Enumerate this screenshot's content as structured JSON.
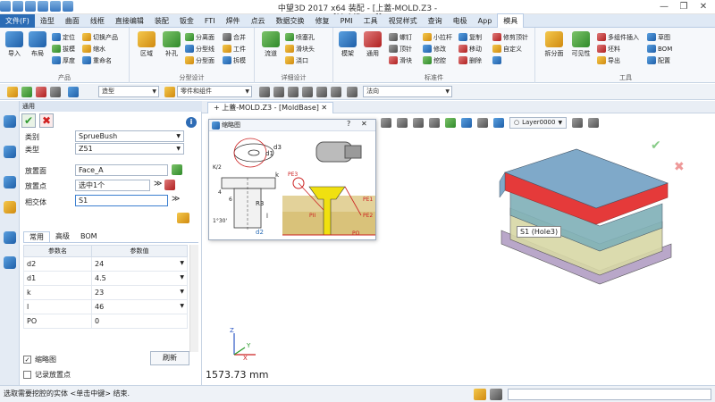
{
  "window": {
    "title": "中望3D 2017    x64          装配 - [上蓋-MOLD.Z3 - [MoldBase]]",
    "controls": [
      "minimize-icon",
      "restore-icon",
      "close-icon"
    ]
  },
  "menu": {
    "items": [
      "文件(F)",
      "造型",
      "曲面",
      "线框",
      "直接编辑",
      "装配",
      "钣金",
      "FTI",
      "焊件",
      "点云",
      "数据交换",
      "修复",
      "PMI",
      "工具",
      "视觉样式",
      "查询",
      "电极",
      "App",
      "模具"
    ],
    "active": "模具"
  },
  "ribbon": {
    "groups": [
      {
        "label": "产品",
        "big": [
          {
            "label": "导入",
            "icon": "import-icon"
          },
          {
            "label": "布局",
            "icon": "layout-icon"
          }
        ],
        "small": [
          "定位",
          "拔模",
          "厚度",
          "切换产品",
          "缩水",
          "重命名"
        ]
      },
      {
        "label": "分型设计",
        "big": [
          {
            "label": "区域",
            "icon": "region-icon"
          },
          {
            "label": "补孔",
            "icon": "patch-hole-icon"
          }
        ],
        "small": [
          "分离面",
          "分型线",
          "分型面",
          "合并",
          "工件",
          "拆模"
        ]
      },
      {
        "label": "详细设计",
        "big": [
          {
            "label": "流道",
            "icon": "runner-icon"
          }
        ],
        "small": [
          "喷塞孔",
          "滑块头",
          "浇口"
        ]
      },
      {
        "label": "标准件",
        "big": [
          {
            "label": "模架",
            "icon": "mold-base-icon"
          },
          {
            "label": "通用",
            "icon": "general-icon"
          }
        ],
        "small": [
          "螺钉",
          "顶针",
          "滑块",
          "小拉杆",
          "修改",
          "挖腔",
          "复制",
          "移动",
          "删除",
          "修剪顶针",
          "自定义"
        ]
      },
      {
        "label": "工具",
        "big": [
          {
            "label": "拆分面",
            "icon": "split-face-icon"
          },
          {
            "label": "可见性",
            "icon": "visibility-icon"
          }
        ],
        "small": [
          "多组件插入",
          "坯料",
          "导出",
          "草图",
          "BOM",
          "配置"
        ]
      }
    ]
  },
  "toolbar2": {
    "mode_combo": "造型",
    "filter_combo": "零件和组件",
    "direction_combo": "法向"
  },
  "panel": {
    "header": "通用",
    "fields": {
      "category_label": "类别",
      "category_value": "SprueBush",
      "type_label": "类型",
      "type_value": "Z51",
      "place_face_label": "放置面",
      "place_face_value": "Face_A",
      "place_point_label": "放置点",
      "place_point_value": "选中1个",
      "intersect_label": "相交体",
      "intersect_value": "S1"
    },
    "tabs": [
      "常用",
      "高级",
      "BOM"
    ],
    "active_tab": "常用",
    "table": {
      "headers": [
        "参数名",
        "参数值"
      ],
      "rows": [
        {
          "name": "d2",
          "value": "24"
        },
        {
          "name": "d1",
          "value": "4.5"
        },
        {
          "name": "k",
          "value": "23"
        },
        {
          "name": "l",
          "value": "46"
        },
        {
          "name": "PO",
          "value": "0"
        }
      ]
    },
    "thumbnail_check": "缩略图",
    "thumbnail_checked": true,
    "record_point_check": "记录放置点",
    "refresh_button": "刷新"
  },
  "viewport": {
    "tab": "上蓋-MOLD.Z3 - [MoldBase]",
    "layer": "Layer0000",
    "popup_title": "缩略图",
    "popup_labels": {
      "d1": "d1",
      "d3": "d3",
      "k2": "K/2",
      "k": "k",
      "r3": "R3",
      "d2": "d2",
      "l": "l",
      "angle": "1°30'",
      "p4": "4",
      "p6": "6",
      "pe1": "PE1",
      "pe2": "PE2",
      "pe3": "PE3",
      "pii": "PII",
      "po": "PO"
    },
    "hover_label": "S1 (Hole3)",
    "distance": "1573.73 mm",
    "axes": {
      "x": "X",
      "y": "Y",
      "z": "Z"
    }
  },
  "status": {
    "message": "选取需要挖腔的实体 <单击中键> 结束."
  }
}
